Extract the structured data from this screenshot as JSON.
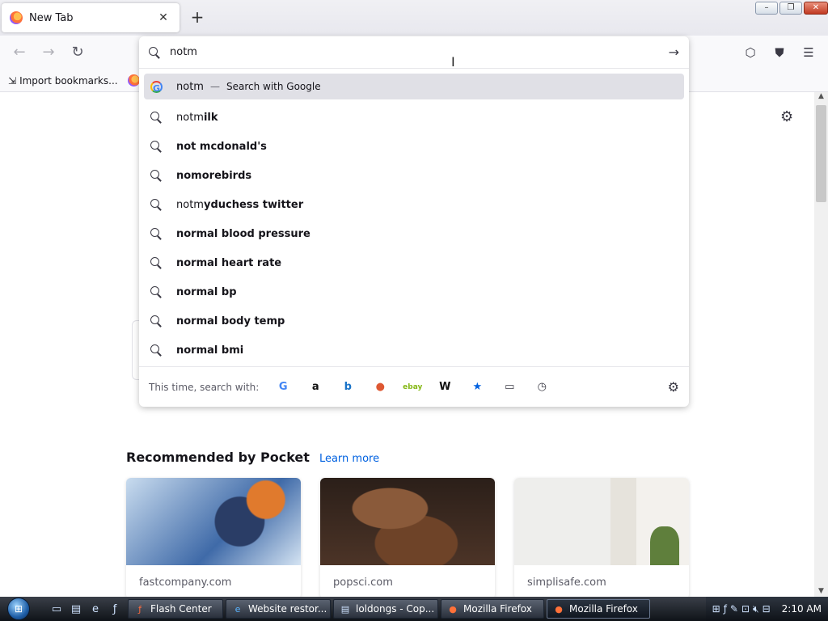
{
  "browser": {
    "tab": {
      "title": "New Tab",
      "close": "✕"
    },
    "new_tab": "+",
    "window_buttons": {
      "minimize": "–",
      "restore": "❐",
      "close": "✕"
    },
    "nav": {
      "back": "←",
      "forward": "→",
      "reload": "↻"
    },
    "toolbar_icons": [
      "pocket-icon",
      "ublock-icon",
      "menu-icon"
    ],
    "bookmarks": {
      "import_label": "Import bookmarks..."
    }
  },
  "urlbar": {
    "value": "notm",
    "go": "→",
    "suggestions": [
      {
        "prefix": "notm",
        "suffix": "",
        "separator": "—",
        "action": "Search with Google",
        "icon": "google-icon",
        "selected": true
      },
      {
        "prefix": "notm",
        "suffix": "ilk"
      },
      {
        "prefix": "",
        "suffix": "not mcdonald's"
      },
      {
        "prefix": "",
        "suffix": "nomorebirds"
      },
      {
        "prefix": "notm",
        "suffix": "yduchess twitter"
      },
      {
        "prefix": "",
        "suffix": "normal blood pressure"
      },
      {
        "prefix": "",
        "suffix": "normal heart rate"
      },
      {
        "prefix": "",
        "suffix": "normal bp"
      },
      {
        "prefix": "",
        "suffix": "normal body temp"
      },
      {
        "prefix": "",
        "suffix": "normal bmi"
      }
    ],
    "oneoff": {
      "label": "This time, search with:",
      "engines": [
        {
          "name": "google-icon",
          "glyph": "G",
          "color": "#4285f4"
        },
        {
          "name": "amazon-icon",
          "glyph": "a",
          "color": "#111111"
        },
        {
          "name": "bing-icon",
          "glyph": "b",
          "color": "#1a73c8"
        },
        {
          "name": "duckduckgo-icon",
          "glyph": "●",
          "color": "#de5833"
        },
        {
          "name": "ebay-icon",
          "glyph": "ebay",
          "color": "#86b817"
        },
        {
          "name": "wikipedia-icon",
          "glyph": "W",
          "color": "#111111"
        },
        {
          "name": "bookmarks-star-icon",
          "glyph": "★",
          "color": "#0061e0"
        },
        {
          "name": "tabs-icon",
          "glyph": "▭",
          "color": "#3a3944"
        },
        {
          "name": "history-icon",
          "glyph": "◷",
          "color": "#3a3944"
        }
      ]
    }
  },
  "pocket": {
    "heading": "Recommended by Pocket",
    "learn_more": "Learn more",
    "cards": [
      {
        "source": "fastcompany.com"
      },
      {
        "source": "popsci.com"
      },
      {
        "source": "simplisafe.com"
      }
    ]
  },
  "taskbar": {
    "tasks": [
      {
        "label": "Flash Center",
        "icon": "flash-icon"
      },
      {
        "label": "Website restor...",
        "icon": "ie-icon"
      },
      {
        "label": "loldongs - Cop...",
        "icon": "notepad-icon"
      },
      {
        "label": "Mozilla Firefox",
        "icon": "firefox-icon"
      },
      {
        "label": "Mozilla Firefox",
        "icon": "firefox-icon",
        "active": true
      }
    ],
    "clock": "2:10 AM"
  }
}
